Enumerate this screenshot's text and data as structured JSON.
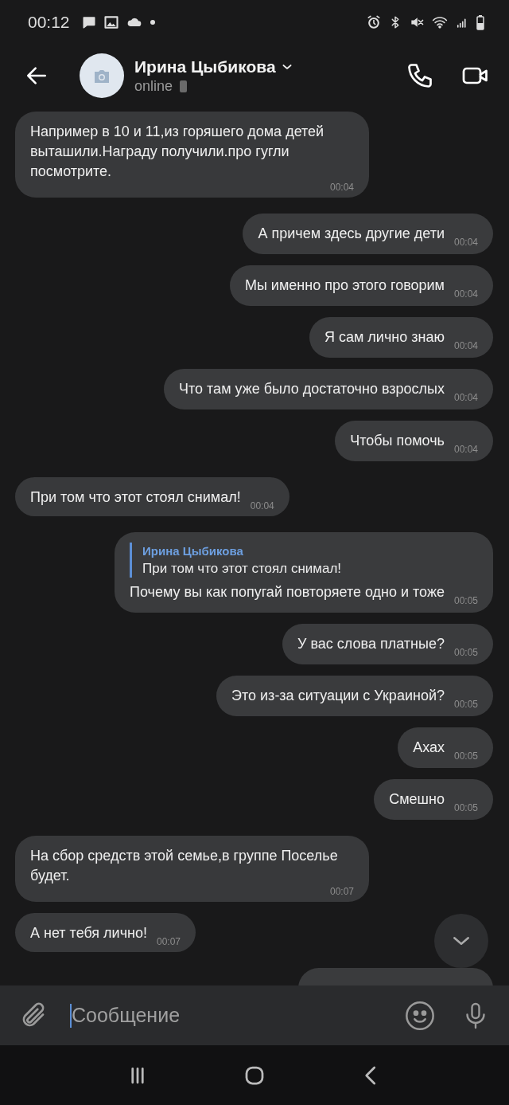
{
  "status_bar": {
    "time": "00:12"
  },
  "header": {
    "name": "Ирина Цыбикова",
    "status": "online"
  },
  "messages": [
    {
      "kind": "incoming",
      "text": "Например в 10 и 11,из горяшего дома детей выташили.Награду получили.про гугли посмотрите.",
      "time": "00:04"
    },
    {
      "kind": "outgoing",
      "text": "А причем здесь другие дети",
      "time": "00:04"
    },
    {
      "kind": "outgoing",
      "text": "Мы именно про этого говорим",
      "time": "00:04"
    },
    {
      "kind": "outgoing",
      "text": "Я сам лично знаю",
      "time": "00:04"
    },
    {
      "kind": "outgoing",
      "text": "Что там уже было достаточно взрослых",
      "time": "00:04"
    },
    {
      "kind": "outgoing",
      "text": "Чтобы помочь",
      "time": "00:04"
    },
    {
      "kind": "incoming",
      "text": "При том что этот стоял снимал!",
      "time": "00:04"
    },
    {
      "kind": "outgoing",
      "reply": {
        "author": "Ирина Цыбикова",
        "text": "При том что этот стоял снимал!"
      },
      "text": "Почему вы как попугай повторяете одно и тоже",
      "time": "00:05"
    },
    {
      "kind": "outgoing",
      "text": "У вас слова платные?",
      "time": "00:05"
    },
    {
      "kind": "outgoing",
      "text": "Это из-за ситуации с Украиной?",
      "time": "00:05"
    },
    {
      "kind": "outgoing",
      "text": "Ахах",
      "time": "00:05"
    },
    {
      "kind": "outgoing",
      "text": "Смешно",
      "time": "00:05"
    },
    {
      "kind": "incoming",
      "text": "На сбор средств этой семье,в группе Поселье будет.",
      "time": "00:07"
    },
    {
      "kind": "incoming",
      "text": "А нет тебя лично!",
      "time": "00:07"
    },
    {
      "kind": "outgoing"
    }
  ],
  "composer": {
    "placeholder": "Сообщение"
  }
}
